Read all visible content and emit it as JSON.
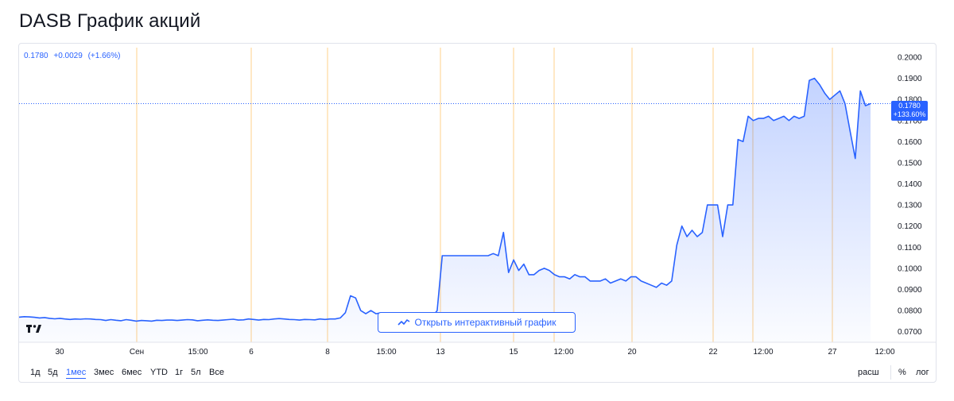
{
  "page_title": "DASB График акций",
  "legend": {
    "price": "0.1780",
    "change": "+0.0029",
    "change_pct": "(+1.66%)"
  },
  "last_price_tag": {
    "price": "0.1780",
    "change_pct": "+133.60%"
  },
  "interactive_button": {
    "label": "Открыть интерактивный график",
    "icon": "line-chart-icon"
  },
  "ranges": [
    {
      "label": "1д",
      "active": false
    },
    {
      "label": "5д",
      "active": false
    },
    {
      "label": "1мес",
      "active": true
    },
    {
      "label": "3мес",
      "active": false
    },
    {
      "label": "6мес",
      "active": false
    },
    {
      "label": "YTD",
      "active": false
    },
    {
      "label": "1г",
      "active": false
    },
    {
      "label": "5л",
      "active": false
    },
    {
      "label": "Все",
      "active": false
    }
  ],
  "right_buttons": {
    "extended": "расш",
    "percent": "%",
    "log": "лог"
  },
  "colors": {
    "line": "#2962ff",
    "area_top": "#2962ff",
    "session_line": "#ffe0b2",
    "grid_label": "#131722"
  },
  "chart_data": {
    "type": "area",
    "title": "",
    "xlabel": "",
    "ylabel": "",
    "ylim": [
      0.065,
      0.2045
    ],
    "y_ticks": [
      "0.2000",
      "0.1900",
      "0.1800",
      "0.1700",
      "0.1600",
      "0.1500",
      "0.1400",
      "0.1300",
      "0.1200",
      "0.1100",
      "0.1000",
      "0.0900",
      "0.0800",
      "0.0700"
    ],
    "x_tick_labels": [
      "30",
      "Сен",
      "15:00",
      "6",
      "8",
      "15:00",
      "13",
      "15",
      "12:00",
      "20",
      "22",
      "12:00",
      "27",
      "12:00"
    ],
    "session_breaks": [
      "30",
      "Сен",
      "6",
      "8",
      "13",
      "15",
      "12:00",
      "20",
      "22",
      "12:00",
      "27"
    ],
    "last_value": 0.178,
    "series": [
      {
        "values": [
          0.0769,
          0.0771,
          0.077,
          0.0768,
          0.0765,
          0.0767,
          0.0763,
          0.0761,
          0.0763,
          0.076,
          0.0758,
          0.076,
          0.0759,
          0.0761,
          0.076,
          0.0758,
          0.0757,
          0.0753,
          0.0757,
          0.0754,
          0.0752,
          0.0757,
          0.0754,
          0.075,
          0.0753,
          0.0752,
          0.075,
          0.0754,
          0.0753,
          0.0755,
          0.0755,
          0.0753,
          0.0755,
          0.0757,
          0.0756,
          0.0752,
          0.0754,
          0.0756,
          0.0754,
          0.0753,
          0.0755,
          0.0757,
          0.0759,
          0.0755,
          0.0756,
          0.076,
          0.0758,
          0.0755,
          0.0758,
          0.0757,
          0.076,
          0.0762,
          0.076,
          0.0758,
          0.0757,
          0.0755,
          0.0758,
          0.0757,
          0.0756,
          0.076,
          0.0758,
          0.076,
          0.076,
          0.0765,
          0.079,
          0.087,
          0.086,
          0.08,
          0.0785,
          0.08,
          0.0785,
          0.079,
          0.077,
          0.077,
          0.0775,
          0.077,
          0.0765,
          0.077,
          0.0765,
          0.0768,
          0.0762,
          0.077,
          0.08,
          0.106,
          0.106,
          0.106,
          0.106,
          0.106,
          0.106,
          0.106,
          0.106,
          0.106,
          0.106,
          0.107,
          0.106,
          0.117,
          0.098,
          0.104,
          0.099,
          0.102,
          0.097,
          0.097,
          0.099,
          0.1,
          0.099,
          0.097,
          0.096,
          0.096,
          0.095,
          0.097,
          0.096,
          0.096,
          0.094,
          0.094,
          0.094,
          0.095,
          0.093,
          0.094,
          0.095,
          0.094,
          0.096,
          0.096,
          0.094,
          0.093,
          0.092,
          0.091,
          0.093,
          0.092,
          0.094,
          0.111,
          0.12,
          0.115,
          0.118,
          0.115,
          0.117,
          0.13,
          0.13,
          0.13,
          0.115,
          0.13,
          0.13,
          0.161,
          0.16,
          0.172,
          0.17,
          0.171,
          0.171,
          0.172,
          0.17,
          0.171,
          0.172,
          0.17,
          0.172,
          0.171,
          0.172,
          0.189,
          0.19,
          0.187,
          0.183,
          0.18,
          0.182,
          0.184,
          0.178,
          0.165,
          0.152,
          0.184,
          0.177,
          0.178
        ]
      }
    ]
  }
}
